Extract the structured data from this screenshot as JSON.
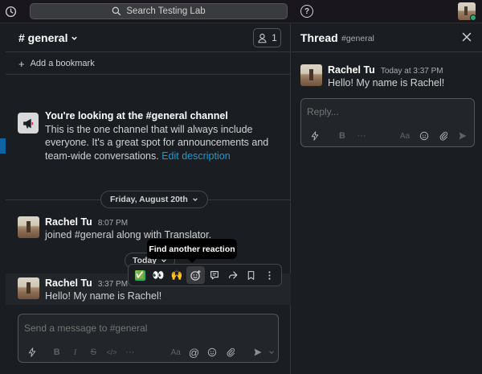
{
  "topbar": {
    "search_placeholder": "Search Testing Lab",
    "help_label": "?"
  },
  "channel": {
    "name": "# general",
    "member_count": "1",
    "add_bookmark": "Add a bookmark"
  },
  "intro": {
    "heading_prefix": "You're looking at the ",
    "heading_channel": "#general",
    "heading_suffix": " channel",
    "body": "This is the one channel that will always include everyone. It's a great spot for announcements and team-wide conversations. ",
    "edit_link": "Edit description"
  },
  "date_divider": "Friday, August 20th",
  "messages": [
    {
      "author": "Rachel Tu",
      "time": "8:07 PM",
      "text": "joined #general along with Translator."
    },
    {
      "author": "Rachel Tu",
      "time": "3:37 PM",
      "text": "Hello! My name is Rachel!"
    }
  ],
  "today_label": "Today",
  "tooltip": "Find another reaction",
  "reactions": [
    "✅",
    "👀",
    "🙌"
  ],
  "composer": {
    "placeholder": "Send a message to #general"
  },
  "thread": {
    "title": "Thread",
    "channel": "#general",
    "message": {
      "author": "Rachel Tu",
      "time": "Today at 3:37 PM",
      "text": "Hello! My name is Rachel!"
    },
    "reply_placeholder": "Reply..."
  },
  "colors": {
    "background": "#1a1d21",
    "link": "#1d9bd1",
    "online": "#2bac76",
    "accent": "#1164a3"
  }
}
